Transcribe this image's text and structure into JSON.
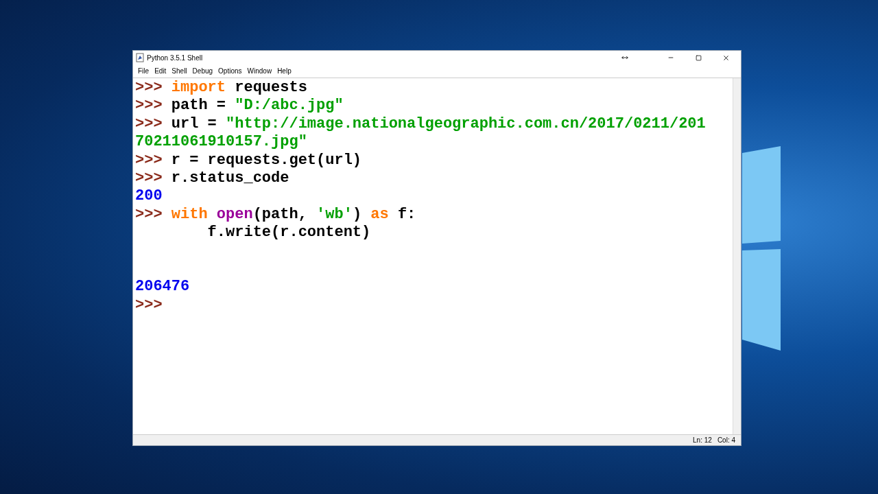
{
  "window": {
    "title": "Python 3.5.1 Shell"
  },
  "menu": [
    "File",
    "Edit",
    "Shell",
    "Debug",
    "Options",
    "Window",
    "Help"
  ],
  "lines": [
    {
      "kind": "code",
      "segments": [
        {
          "kind": "prompt",
          "text": ">>> "
        },
        {
          "kind": "keyword",
          "text": "import"
        },
        {
          "kind": "plain",
          "text": " requests"
        }
      ]
    },
    {
      "kind": "code",
      "segments": [
        {
          "kind": "prompt",
          "text": ">>> "
        },
        {
          "kind": "plain",
          "text": "path = "
        },
        {
          "kind": "string",
          "text": "\"D:/abc.jpg\""
        }
      ]
    },
    {
      "kind": "code",
      "segments": [
        {
          "kind": "prompt",
          "text": ">>> "
        },
        {
          "kind": "plain",
          "text": "url = "
        },
        {
          "kind": "string",
          "text": "\"http://image.nationalgeographic.com.cn/2017/0211/201"
        }
      ]
    },
    {
      "kind": "code",
      "segments": [
        {
          "kind": "string",
          "text": "70211061910157.jpg\""
        }
      ]
    },
    {
      "kind": "code",
      "segments": [
        {
          "kind": "prompt",
          "text": ">>> "
        },
        {
          "kind": "plain",
          "text": "r = requests.get(url)"
        }
      ]
    },
    {
      "kind": "code",
      "segments": [
        {
          "kind": "prompt",
          "text": ">>> "
        },
        {
          "kind": "plain",
          "text": "r.status_code"
        }
      ]
    },
    {
      "kind": "code",
      "segments": [
        {
          "kind": "output",
          "text": "200"
        }
      ]
    },
    {
      "kind": "code",
      "segments": [
        {
          "kind": "prompt",
          "text": ">>> "
        },
        {
          "kind": "keyword",
          "text": "with "
        },
        {
          "kind": "builtin",
          "text": "open"
        },
        {
          "kind": "plain",
          "text": "(path, "
        },
        {
          "kind": "string",
          "text": "'wb'"
        },
        {
          "kind": "plain",
          "text": ") "
        },
        {
          "kind": "keyword",
          "text": "as"
        },
        {
          "kind": "plain",
          "text": " f:"
        }
      ]
    },
    {
      "kind": "code",
      "segments": [
        {
          "kind": "plain",
          "text": "        f.write(r.content)"
        }
      ]
    },
    {
      "kind": "blank"
    },
    {
      "kind": "blank"
    },
    {
      "kind": "code",
      "segments": [
        {
          "kind": "output",
          "text": "206476"
        }
      ]
    },
    {
      "kind": "code",
      "segments": [
        {
          "kind": "prompt",
          "text": ">>> "
        }
      ]
    }
  ],
  "status_bar": {
    "line": "Ln: 12",
    "column": "Col: 4"
  }
}
